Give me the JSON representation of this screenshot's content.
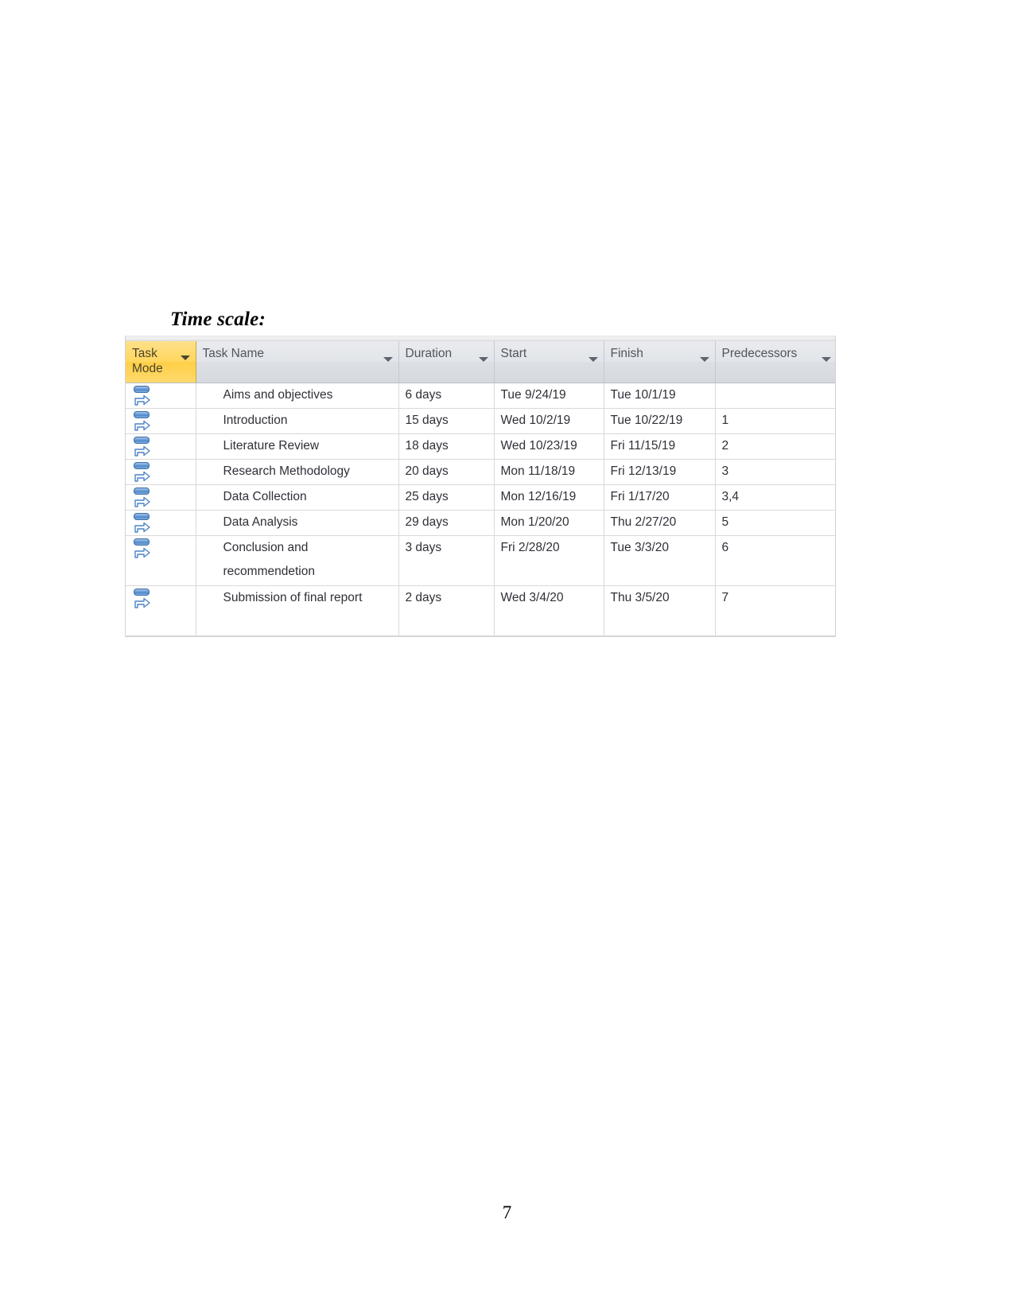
{
  "document": {
    "section_heading": "Time scale:",
    "page_number": "7"
  },
  "grid": {
    "columns": [
      {
        "key": "task_mode",
        "label": "Task\nMode",
        "has_filter": true,
        "highlighted": true
      },
      {
        "key": "task_name",
        "label": "Task Name",
        "has_filter": true,
        "highlighted": false
      },
      {
        "key": "duration",
        "label": "Duration",
        "has_filter": true,
        "highlighted": false
      },
      {
        "key": "start",
        "label": "Start",
        "has_filter": true,
        "highlighted": false
      },
      {
        "key": "finish",
        "label": "Finish",
        "has_filter": true,
        "highlighted": false
      },
      {
        "key": "predecessors",
        "label": "Predecessors",
        "has_filter": true,
        "highlighted": false
      }
    ],
    "rows": [
      {
        "task_mode_icon": "auto-scheduled-icon",
        "task_name": "Aims and objectives",
        "duration": "6 days",
        "start": "Tue 9/24/19",
        "finish": "Tue 10/1/19",
        "predecessors": ""
      },
      {
        "task_mode_icon": "auto-scheduled-icon",
        "task_name": "Introduction",
        "duration": "15 days",
        "start": "Wed 10/2/19",
        "finish": "Tue 10/22/19",
        "predecessors": "1"
      },
      {
        "task_mode_icon": "auto-scheduled-icon",
        "task_name": "Literature Review",
        "duration": "18 days",
        "start": "Wed 10/23/19",
        "finish": "Fri 11/15/19",
        "predecessors": "2"
      },
      {
        "task_mode_icon": "auto-scheduled-icon",
        "task_name": "Research Methodology",
        "duration": "20 days",
        "start": "Mon 11/18/19",
        "finish": "Fri 12/13/19",
        "predecessors": "3"
      },
      {
        "task_mode_icon": "auto-scheduled-icon",
        "task_name": "Data Collection",
        "duration": "25 days",
        "start": "Mon 12/16/19",
        "finish": "Fri 1/17/20",
        "predecessors": "3,4"
      },
      {
        "task_mode_icon": "auto-scheduled-icon",
        "task_name": "Data Analysis",
        "duration": "29 days",
        "start": "Mon 1/20/20",
        "finish": "Thu 2/27/20",
        "predecessors": "5"
      },
      {
        "task_mode_icon": "auto-scheduled-icon",
        "task_name": "Conclusion and recommendetion",
        "duration": "3 days",
        "start": "Fri 2/28/20",
        "finish": "Tue 3/3/20",
        "predecessors": "6"
      },
      {
        "task_mode_icon": "auto-scheduled-icon",
        "task_name": "Submission of final report",
        "duration": "2 days",
        "start": "Wed 3/4/20",
        "finish": "Thu 3/5/20",
        "predecessors": "7"
      }
    ]
  },
  "colors": {
    "task_mode_header": "#ffd75e",
    "header_gradient_top": "#e9ebee",
    "header_gradient_bottom": "#d6dade",
    "grid_line": "#d9d9d9",
    "icon_blue": "#4d84c6",
    "text": "#2f2f38"
  }
}
